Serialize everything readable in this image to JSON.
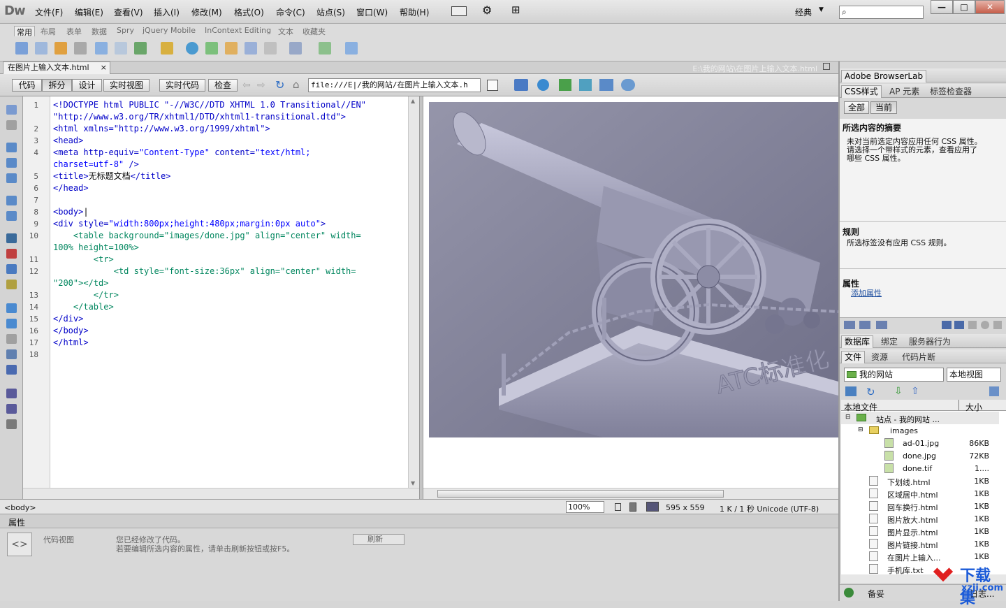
{
  "app": {
    "logo": "Dw"
  },
  "menu": [
    "文件(F)",
    "编辑(E)",
    "查看(V)",
    "插入(I)",
    "修改(M)",
    "格式(O)",
    "命令(C)",
    "站点(S)",
    "窗口(W)",
    "帮助(H)"
  ],
  "workspace": "经典",
  "window_buttons": {
    "min": "—",
    "max": "□",
    "close": "✕"
  },
  "insert_tabs": [
    "常用",
    "布局",
    "表单",
    "数据",
    "Spry",
    "jQuery Mobile",
    "InContext Editing",
    "文本",
    "收藏夹"
  ],
  "doc": {
    "tab_label": "在图片上输入文本.html",
    "close": "×",
    "path": "E:\\我的网站\\在图片上输入文本.html",
    "view_buttons": [
      "代码",
      "拆分",
      "设计",
      "实时视图"
    ],
    "live_code": "实时代码",
    "inspect": "检查",
    "url": "file:///E|/我的网站/在图片上输入文本.h"
  },
  "code_lines": [
    {
      "n": "1",
      "html": "<span class=\"tag\">&lt;!DOCTYPE html PUBLIC \"-//W3C//DTD XHTML 1.0 Transitional//EN\"</span>"
    },
    {
      "n": "",
      "html": "<span class=\"tag\">\"http://www.w3.org/TR/xhtml1/DTD/xhtml1-transitional.dtd\"&gt;</span>"
    },
    {
      "n": "2",
      "html": "<span class=\"tag\">&lt;html xmlns=\"http://www.w3.org/1999/xhtml\"&gt;</span>"
    },
    {
      "n": "3",
      "html": "<span class=\"tag\">&lt;head&gt;</span>"
    },
    {
      "n": "4",
      "html": "<span class=\"tag\">&lt;meta http-equiv=</span><span class=\"val\">\"Content-Type\"</span><span class=\"tag\"> content=</span><span class=\"val\">\"text/html;</span>"
    },
    {
      "n": "",
      "html": "<span class=\"val\">charset=utf-8\"</span><span class=\"tag\"> /&gt;</span>"
    },
    {
      "n": "5",
      "html": "<span class=\"tag\">&lt;title&gt;</span><span class=\"txt\">无标题文档</span><span class=\"tag\">&lt;/title&gt;</span>"
    },
    {
      "n": "6",
      "html": "<span class=\"tag\">&lt;/head&gt;</span>"
    },
    {
      "n": "7",
      "html": ""
    },
    {
      "n": "8",
      "html": "<span class=\"tag\">&lt;body&gt;</span><span class=\"txt\">|</span>"
    },
    {
      "n": "9",
      "html": "<span class=\"tag\">&lt;div style=</span><span class=\"val\">\"width:800px;height:480px;margin:0px auto\"</span><span class=\"tag\">&gt;</span>"
    },
    {
      "n": "10",
      "html": "<span class=\"tagt\">    &lt;table background=<span class=\"val\">\"images/done.jpg\"</span> align=<span class=\"val\">\"center\"</span> width=</span>"
    },
    {
      "n": "",
      "html": "<span class=\"tagt\"><span class=\"val\">100%</span> height=<span class=\"val\">100%</span>&gt;</span>"
    },
    {
      "n": "11",
      "html": "<span class=\"tagt\">        &lt;tr&gt;</span>"
    },
    {
      "n": "12",
      "html": "<span class=\"tagt\">            &lt;td style=<span class=\"val\">\"font-size:36px\"</span> align=<span class=\"val\">\"center\"</span> width=</span>"
    },
    {
      "n": "",
      "html": "<span class=\"tagt\"><span class=\"val\">\"200\"</span>&gt;&lt;/td&gt;</span>"
    },
    {
      "n": "13",
      "html": "<span class=\"tagt\">        &lt;/tr&gt;</span>"
    },
    {
      "n": "14",
      "html": "<span class=\"tagt\">    &lt;/table&gt;</span>"
    },
    {
      "n": "15",
      "html": "<span class=\"tag\">&lt;/div&gt;</span>"
    },
    {
      "n": "16",
      "html": "<span class=\"tag\">&lt;/body&gt;</span>"
    },
    {
      "n": "17",
      "html": "<span class=\"tag\">&lt;/html&gt;</span>"
    },
    {
      "n": "18",
      "html": ""
    }
  ],
  "design": {
    "watermark_text": "ATC标准化"
  },
  "status": {
    "tag": "<body>",
    "zoom": "100%",
    "size": "595 x 559",
    "info": "1 K / 1 秒  Unicode (UTF-8)"
  },
  "properties": {
    "title": "属性",
    "mode": "代码视图",
    "note": "您已经修改了代码。",
    "note2": "若要编辑所选内容的属性，请单击刷新按钮或按F5。",
    "refresh": "刷新"
  },
  "right": {
    "browserlab": "Adobe BrowserLab",
    "css_tabs": [
      "CSS样式",
      "AP 元素",
      "标签检查器"
    ],
    "mode_buttons": [
      "全部",
      "当前"
    ],
    "summary_title": "所选内容的摘要",
    "summary_text": [
      "未对当前选定内容应用任何 CSS 属性。",
      "请选择一个带样式的元素，查看应用了",
      "哪些 CSS 属性。"
    ],
    "rules_title": "规则",
    "rules_text": "所选标签没有应用 CSS 规则。",
    "props_title": "属性",
    "add_prop": "添加属性",
    "db_tabs": [
      "数据库",
      "绑定",
      "服务器行为"
    ],
    "file_tabs": [
      "文件",
      "资源",
      "代码片断"
    ],
    "site": "我的网站",
    "view": "本地视图",
    "col_local": "本地文件",
    "col_size": "大小",
    "site_root": "站点 - 我的网站 ...",
    "folder": "images",
    "files": [
      {
        "name": "ad-01.jpg",
        "size": "86KB",
        "indent": 1
      },
      {
        "name": "done.jpg",
        "size": "72KB",
        "indent": 1
      },
      {
        "name": "done.tif",
        "size": "1....",
        "indent": 1
      },
      {
        "name": "下划线.html",
        "size": "1KB",
        "indent": 0
      },
      {
        "name": "区域居中.html",
        "size": "1KB",
        "indent": 0
      },
      {
        "name": "回车换行.html",
        "size": "1KB",
        "indent": 0
      },
      {
        "name": "图片放大.html",
        "size": "1KB",
        "indent": 0
      },
      {
        "name": "图片显示.html",
        "size": "1KB",
        "indent": 0
      },
      {
        "name": "图片链接.html",
        "size": "1KB",
        "indent": 0
      },
      {
        "name": "在图片上输入...",
        "size": "1KB",
        "indent": 0
      },
      {
        "name": "手机库.txt",
        "size": "",
        "indent": 0
      }
    ],
    "footer": "备妥",
    "footer_right": "日志..."
  },
  "watermark": {
    "brand": "下载集",
    "url": "xzji.com"
  }
}
